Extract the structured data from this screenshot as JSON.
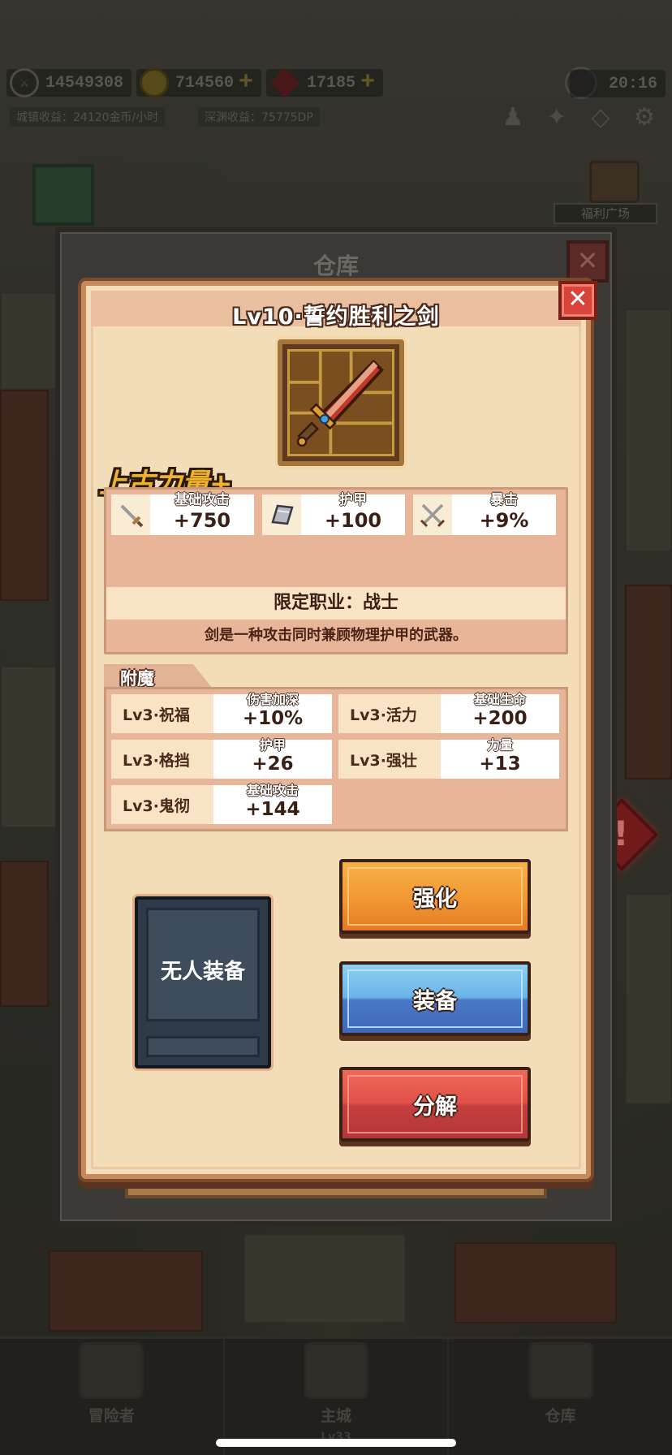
{
  "hud": {
    "power": "14549308",
    "gold": "714560",
    "gems": "17185",
    "time": "20:16",
    "town_income": "城镇收益：24120金币/小时",
    "abyss_income": "深渊收益：75775DP",
    "welfare": "福利广场"
  },
  "warehouse": {
    "title": "仓库",
    "close": "✕"
  },
  "item": {
    "title": "Lv10·誓约胜利之剑",
    "close": "✕",
    "tag": "上古力量+",
    "stats": [
      {
        "label": "基础攻击",
        "value": "+750",
        "icon": "sword-icon"
      },
      {
        "label": "护甲",
        "value": "+100",
        "icon": "armor-plate-icon"
      },
      {
        "label": "暴击",
        "value": "+9%",
        "icon": "crossed-swords-icon"
      }
    ],
    "class_restriction": "限定职业：战士",
    "description": "剑是一种攻击同时兼顾物理护甲的武器。"
  },
  "enchant": {
    "title": "附魔",
    "items": [
      {
        "name": "Lv3·祝福",
        "label": "伤害加深",
        "value": "+10%"
      },
      {
        "name": "Lv3·活力",
        "label": "基础生命",
        "value": "+200"
      },
      {
        "name": "Lv3·格挡",
        "label": "护甲",
        "value": "+26"
      },
      {
        "name": "Lv3·强壮",
        "label": "力量",
        "value": "+13"
      },
      {
        "name": "Lv3·鬼彻",
        "label": "基础攻击",
        "value": "+144"
      }
    ]
  },
  "equip_slot": {
    "label": "无人装备"
  },
  "buttons": {
    "strengthen": "强化",
    "equip": "装备",
    "decompose": "分解"
  },
  "nav": {
    "adventurer": "冒险者",
    "main_city": "主城",
    "main_city_level": "Lv33",
    "warehouse": "仓库"
  },
  "colors": {
    "modal_bg": "#f3dcb8",
    "modal_border": "#c48a5e",
    "strengthen": "#f29a34",
    "equip": "#4a78c8",
    "decompose": "#c4403e",
    "tag_gold": "#f0b22c"
  }
}
